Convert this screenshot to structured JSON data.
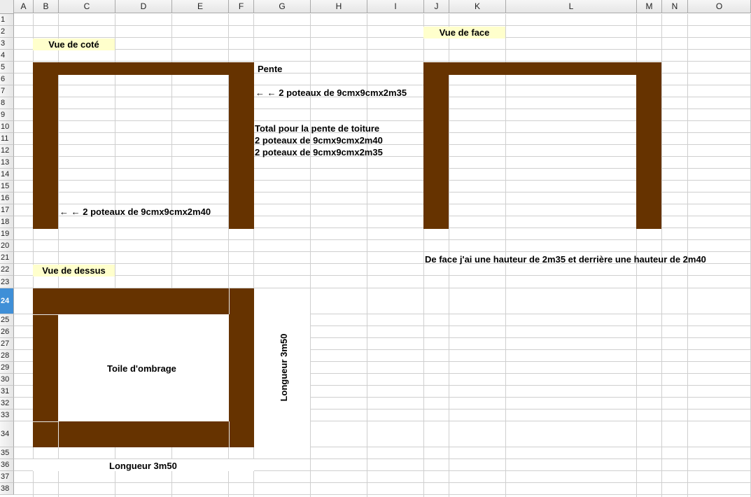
{
  "columns": [
    "A",
    "B",
    "C",
    "D",
    "E",
    "F",
    "G",
    "H",
    "I",
    "J",
    "K",
    "L",
    "M",
    "N",
    "O"
  ],
  "rows": [
    "1",
    "2",
    "3",
    "4",
    "5",
    "6",
    "7",
    "8",
    "9",
    "10",
    "11",
    "12",
    "13",
    "14",
    "15",
    "16",
    "17",
    "18",
    "19",
    "20",
    "21",
    "22",
    "23",
    "24",
    "25",
    "26",
    "27",
    "28",
    "29",
    "30",
    "31",
    "32",
    "33",
    "34",
    "35",
    "36",
    "37",
    "38"
  ],
  "active_row": "24",
  "colors": {
    "wood": "#663300",
    "label_bg": "#ffffcc",
    "active_header": "#3f8fd7"
  },
  "side_view": {
    "title": "Vue de coté",
    "slope": "Pente",
    "posts_right": "← ← 2 poteaux de 9cmx9cmx2m35",
    "posts_left": "← ← 2 poteaux de 9cmx9cmx2m40"
  },
  "total": {
    "line1": "Total pour la pente de toiture",
    "line2": "2 poteaux de 9cmx9cmx2m40",
    "line3": "2 poteaux de 9cmx9cmx2m35"
  },
  "front_view": {
    "title": "Vue de face",
    "note": "De face j'ai une hauteur de 2m35 et derrière une hauteur de 2m40"
  },
  "top_view": {
    "title": "Vue de dessus",
    "shade_cloth": "Toile d'ombrage",
    "length_vertical": "Longueur 3m50",
    "length_horizontal": "Longueur 3m50"
  }
}
